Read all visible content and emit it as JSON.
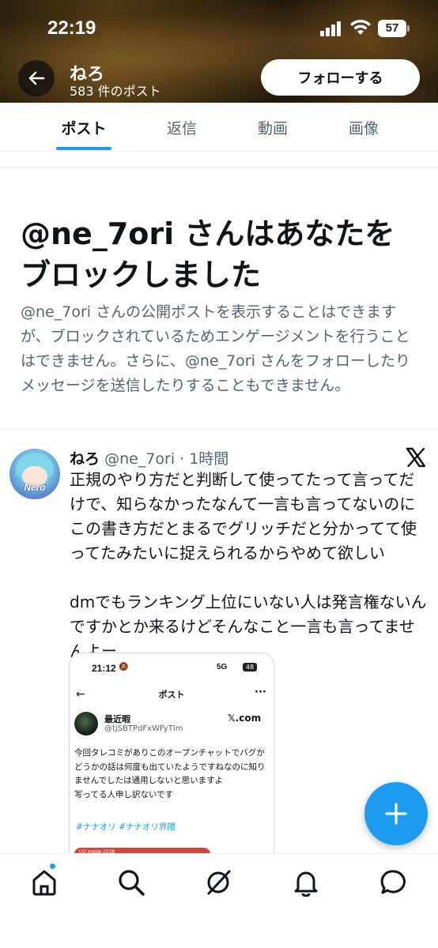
{
  "status_bar": {
    "time": "22:19",
    "battery": "57"
  },
  "header": {
    "profile_name": "ねろ",
    "post_count": "583 件のポスト",
    "follow_label": "フォローする",
    "back_icon": "arrow-left-icon"
  },
  "tabs": [
    {
      "label": "ポスト",
      "active": true
    },
    {
      "label": "返信",
      "active": false
    },
    {
      "label": "動画",
      "active": false
    },
    {
      "label": "画像",
      "active": false
    }
  ],
  "blocked_notice": {
    "title": "@ne_7ori さんはあなたをブロックしました",
    "description": "@ne_7ori さんの公開ポストを表示することはできますが、ブロックされているためエンゲージメントを行うことはできません。さらに、@ne_7ori さんをフォローしたりメッセージを送信したりすることもできません。"
  },
  "post": {
    "author": "ねろ",
    "handle_time": "@ne_7ori · 1時間",
    "avatar_text": "Nero",
    "text": "正規のやり方だと判断して使ってたって言ってだけで、知らなかったなんて一言も言ってないのにこの書き方だとまるでグリッチだと分かってて使ってたみたいに捉えられるからやめて欲しい\n\ndmでもランキング上位にいない人は発言権ないんですかとか来るけどそんなこと一言も言ってませんよー",
    "embed": {
      "time": "21:12",
      "status": "5G",
      "battery": "48",
      "title": "ポスト",
      "name": "最近暇",
      "handle": "@tjSBTPdFxWFyTIm",
      "brand": "𝕏.com",
      "body": "今回タレコミがありこのオープンチャットでバグかどうかの話は何度も出ていたようですねなのに知りませんでしたは通用しないと思いますよ\n写ってる人申し訳ないです",
      "tags": "#ナナオリ #ナナオリ界隈",
      "nested_status": "UQ mobile    23:08"
    }
  },
  "fab": {
    "icon": "plus-icon"
  },
  "bottom_nav": [
    {
      "icon": "home-icon",
      "has_badge": true
    },
    {
      "icon": "search-icon",
      "has_badge": false
    },
    {
      "icon": "grok-icon",
      "has_badge": false
    },
    {
      "icon": "bell-icon",
      "has_badge": false
    },
    {
      "icon": "messages-icon",
      "has_badge": false
    }
  ],
  "colors": {
    "accent": "#1d9bf0",
    "text_primary": "#0f1419",
    "text_secondary": "#536471"
  }
}
